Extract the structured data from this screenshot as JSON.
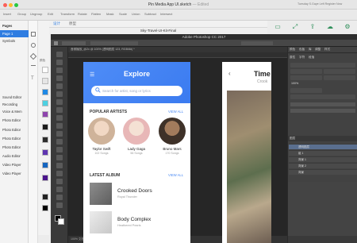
{
  "sketch": {
    "window_title": "Pin Media App UI.sketch",
    "edited_label": "— Edited",
    "account_text": "Tuesday  S.Gaye Left  Register Now",
    "toolbar_items": [
      "Insert",
      "Group",
      "Ungroup",
      "Edit",
      "Transform",
      "Rotate",
      "Flatten",
      "Mask",
      "Scale",
      "Union",
      "Subtract",
      "Intersect"
    ],
    "pages_header": "Pages",
    "pages": [
      {
        "label": "Page 1",
        "active": true
      },
      {
        "label": "Symbols",
        "active": false
      }
    ],
    "layers": [
      "Sound Editor",
      "Recording",
      "Voice & Mem",
      "Photo Editor",
      "Photo Editor",
      "Photo Editor",
      "Photo Editor",
      "Audio Editor",
      "Video Player",
      "Video Player"
    ],
    "palette_label": "颜色",
    "swatch_colors": [
      "#ffffff",
      "#e6e6e6",
      "#1e88e5",
      "#4dd0e1",
      "#8e44ad",
      "#1a1a1a",
      "#2c2c2c",
      "#5e35b1",
      "#1565c0",
      "#4a148c",
      "#222222",
      "#000000"
    ],
    "artboard_tabs": [
      "设计",
      "原型"
    ],
    "artboard_title": "Sky-Travel-UI-Kit-Final"
  },
  "photoshop": {
    "app_title": "Adobe Photoshop CC 2017",
    "doc_tab": "音频播放_@2x @ 100% (透明图层 123, RGB/8#) *",
    "status_text": "100%     文档:16.2M/188.5M",
    "panel_tabs": [
      "颜色",
      "色板",
      "库",
      "调整",
      "样式"
    ],
    "props_tabs": [
      "属性",
      "字符",
      "段落"
    ],
    "layers_tab": "图层",
    "layer_items": [
      {
        "name": "透明图层",
        "selected": true
      },
      {
        "name": "组 1",
        "selected": false
      },
      {
        "name": "背景 1",
        "selected": false
      },
      {
        "name": "背景 2",
        "selected": false
      },
      {
        "name": "背景",
        "selected": false
      }
    ],
    "zoom_value": "100%"
  },
  "phone": {
    "title": "Explore",
    "search_placeholder": "Search for artist, song or lyrics",
    "popular_title": "POPULAR ARTISTS",
    "view_all": "VIEW ALL",
    "artists": [
      {
        "name": "Taylor Swift",
        "songs": "102 Songs",
        "color": "#d8c7b8"
      },
      {
        "name": "Lady Gaga",
        "songs": "56 Songs",
        "color": "#f0c9c9"
      },
      {
        "name": "Bruno Mars",
        "songs": "170 Songs",
        "color": "#5a4a3a"
      }
    ],
    "latest_title": "LATEST ALBUM",
    "albums": [
      {
        "name": "Crooked Doors",
        "artist": "Royal Thunder",
        "color": "#7a7a7a"
      },
      {
        "name": "Body Complex",
        "artist": "Heathered Pearls",
        "color": "#d9d9d9"
      }
    ]
  },
  "phone2": {
    "title": "Time",
    "subtitle": "Crook"
  }
}
